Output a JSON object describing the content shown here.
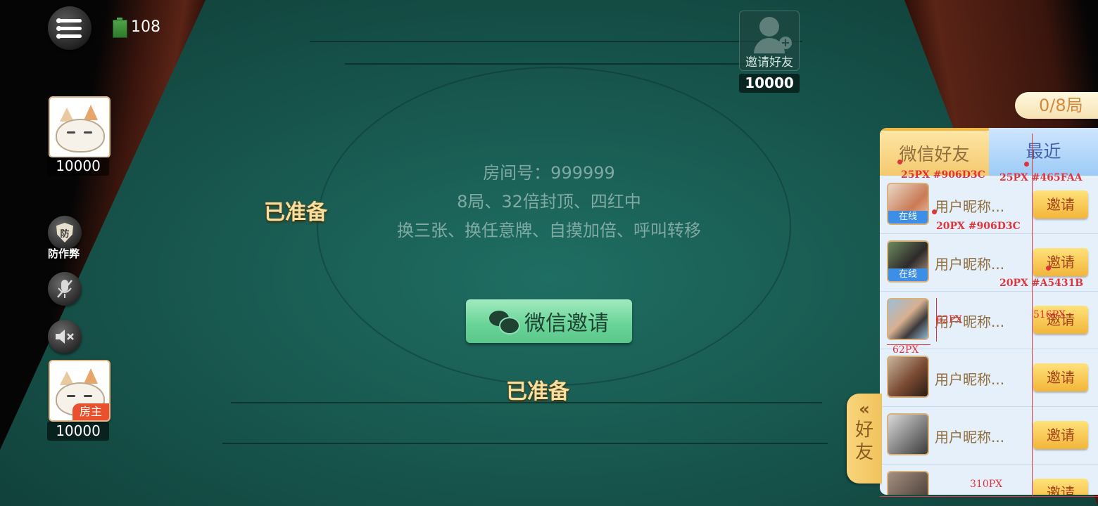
{
  "status": {
    "battery_value": "108"
  },
  "left_panel": {
    "top_player_score": "10000",
    "anti_cheat_label": "防作弊",
    "bottom_player_score": "10000",
    "host_badge": "房主"
  },
  "top_seat": {
    "invite_label": "邀请好友",
    "score": "10000"
  },
  "table": {
    "ready_left": "已准备",
    "ready_bottom": "已准备",
    "room_info": [
      "房间号：999999",
      "8局、32倍封顶、四红中",
      "换三张、换任意牌、自摸加倍、呼叫转移"
    ],
    "wechat_invite_label": "微信邀请"
  },
  "rounds": "0/8局",
  "friends_panel": {
    "tabs": [
      "微信好友",
      "最近"
    ],
    "invite_label": "邀请",
    "side_tab_label": [
      "好",
      "友"
    ],
    "friends": [
      {
        "name": "用户昵称...",
        "online": "在线"
      },
      {
        "name": "用户昵称...",
        "online": "在线"
      },
      {
        "name": "用户昵称...",
        "online": ""
      },
      {
        "name": "用户昵称...",
        "online": ""
      },
      {
        "name": "用户昵称...",
        "online": ""
      },
      {
        "name": "",
        "online": ""
      }
    ]
  },
  "annotations": {
    "tab_wx": "25PX #906D3C",
    "tab_recent": "25PX #465FAA",
    "name_spec": "20PX #906D3C",
    "invite_spec": "20PX #A5431B",
    "avatar_h": "62PX",
    "avatar_w": "62PX",
    "row_w": "516PX",
    "panel_w": "310PX"
  },
  "colors": {
    "felt": "#18584f",
    "tab_wx_text": "#906D3C",
    "tab_recent_text": "#465FAA",
    "invite_text": "#A5431B",
    "ready_gold": "#f6dfa0"
  }
}
